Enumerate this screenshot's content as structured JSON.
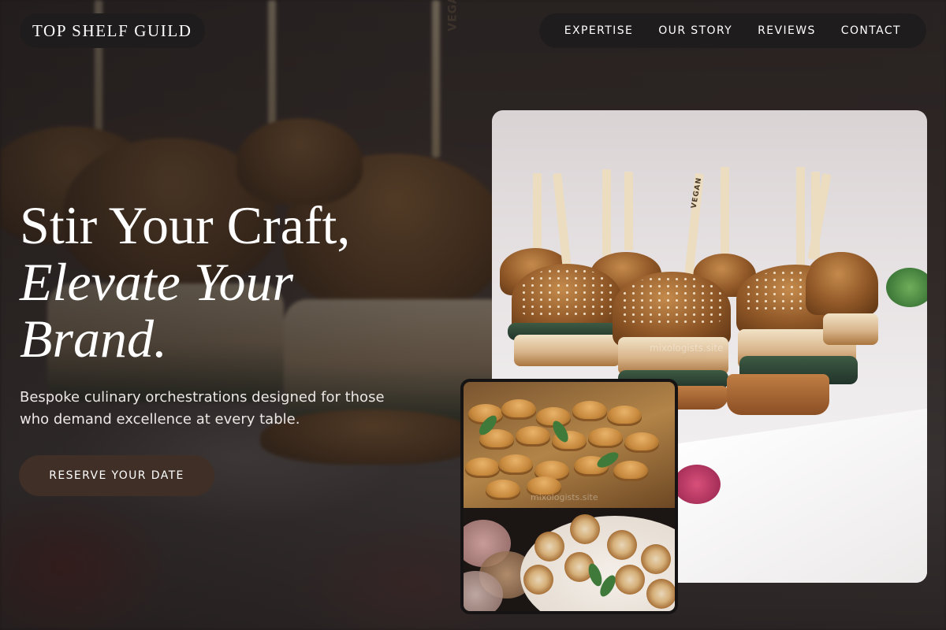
{
  "header": {
    "brand": "TOP SHELF GUILD",
    "nav": [
      {
        "label": "EXPERTISE"
      },
      {
        "label": "OUR STORY"
      },
      {
        "label": "REVIEWS"
      },
      {
        "label": "CONTACT"
      }
    ]
  },
  "hero": {
    "headline_line1": "Stir Your Craft,",
    "headline_line2": "Elevate Your",
    "headline_line3": "Brand.",
    "subtitle": "Bespoke culinary orchestrations designed for those who demand excellence at every table.",
    "cta_label": "RESERVE YOUR DATE"
  },
  "photos": {
    "main_alt": "Gourmet sliders on skewers",
    "main_tag": "VEGAN",
    "secondary_alt": "Croissants and tartlets on a grazing table",
    "watermark": "mixologists.site"
  },
  "colors": {
    "pill_bg": "#1e1c1c",
    "cta_bg": "#3f2f26",
    "text": "#ffffff"
  }
}
